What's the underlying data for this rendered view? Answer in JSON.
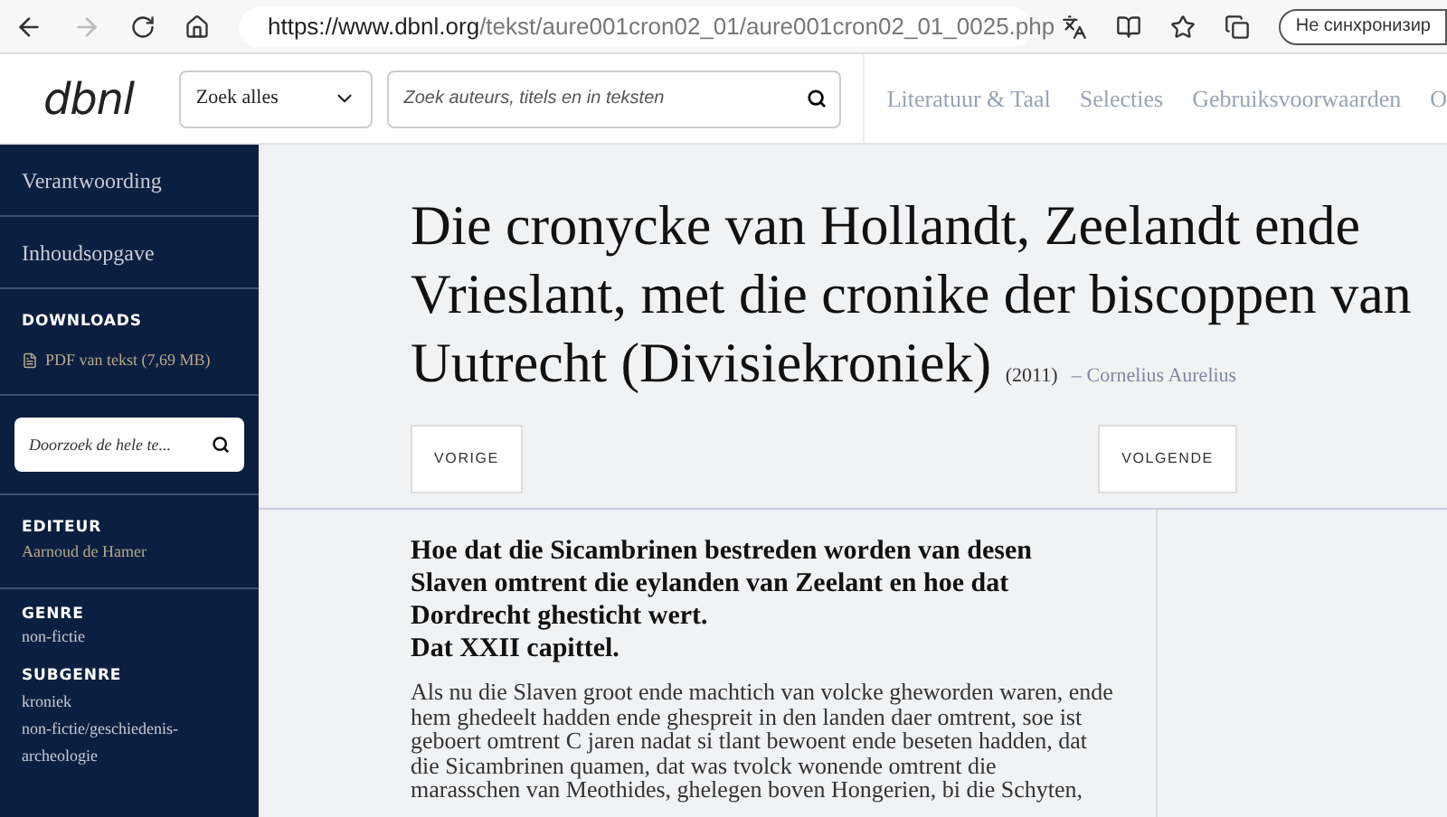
{
  "browser": {
    "url_host": "https://www.dbnl.org",
    "url_path": "/tekst/aure001cron02_01/aure001cron02_01_0025.php",
    "forward_disabled": true,
    "profile_button": "Не синхронизир"
  },
  "header": {
    "logo": "dbnl",
    "scope_select": "Zoek alles",
    "search": {
      "placeholder": "Zoek auteurs, titels en in teksten"
    },
    "nav": [
      "Literatuur & Taal",
      "Selecties",
      "Gebruiksvoorwaarden",
      "O"
    ]
  },
  "sidebar": {
    "links": [
      "Verantwoording",
      "Inhoudsopgave"
    ],
    "downloads": {
      "heading": "DOWNLOADS",
      "items": [
        "PDF van tekst (7,69 MB)"
      ]
    },
    "search": {
      "placeholder": "Doorzoek de hele te..."
    },
    "editor": {
      "heading": "EDITEUR",
      "value": "Aarnoud de Hamer"
    },
    "genre": {
      "heading": "GENRE",
      "values": [
        "non-fictie"
      ]
    },
    "subgenre": {
      "heading": "SUBGENRE",
      "values": [
        "kroniek",
        "non-fictie/geschiedenis-archeologie"
      ]
    }
  },
  "main": {
    "title": "Die cronycke van Hollandt, Zeelandt ende Vrieslant, met die cronike der biscoppen van Uutrecht (Divisiekroniek)",
    "year": "(2011)",
    "author_separator": "–",
    "author": "Cornelius Aurelius",
    "prev_button": "VORIGE",
    "next_button": "VOLGENDE",
    "chapter_heading": [
      "Hoe dat die Sicambrinen bestreden worden van desen Slaven omtrent die eylanden van Zeelant en hoe dat Dordrecht ghesticht wert.",
      "Dat XXII capittel."
    ],
    "paragraph_lines": [
      "Als nu die Slaven groot ende machtich van volcke gheworden waren, ende",
      "hem ghedeelt hadden ende ghespreit in den landen daer omtrent, soe ist",
      "geboert omtrent C jaren nadat si tlant bewoent ende beseten hadden, dat",
      "die Sicambrinen quamen, dat was tvolck wonende omtrent die",
      "marasschen van Meothides, ghelegen boven Hongerien, bi die Schyten,"
    ]
  }
}
